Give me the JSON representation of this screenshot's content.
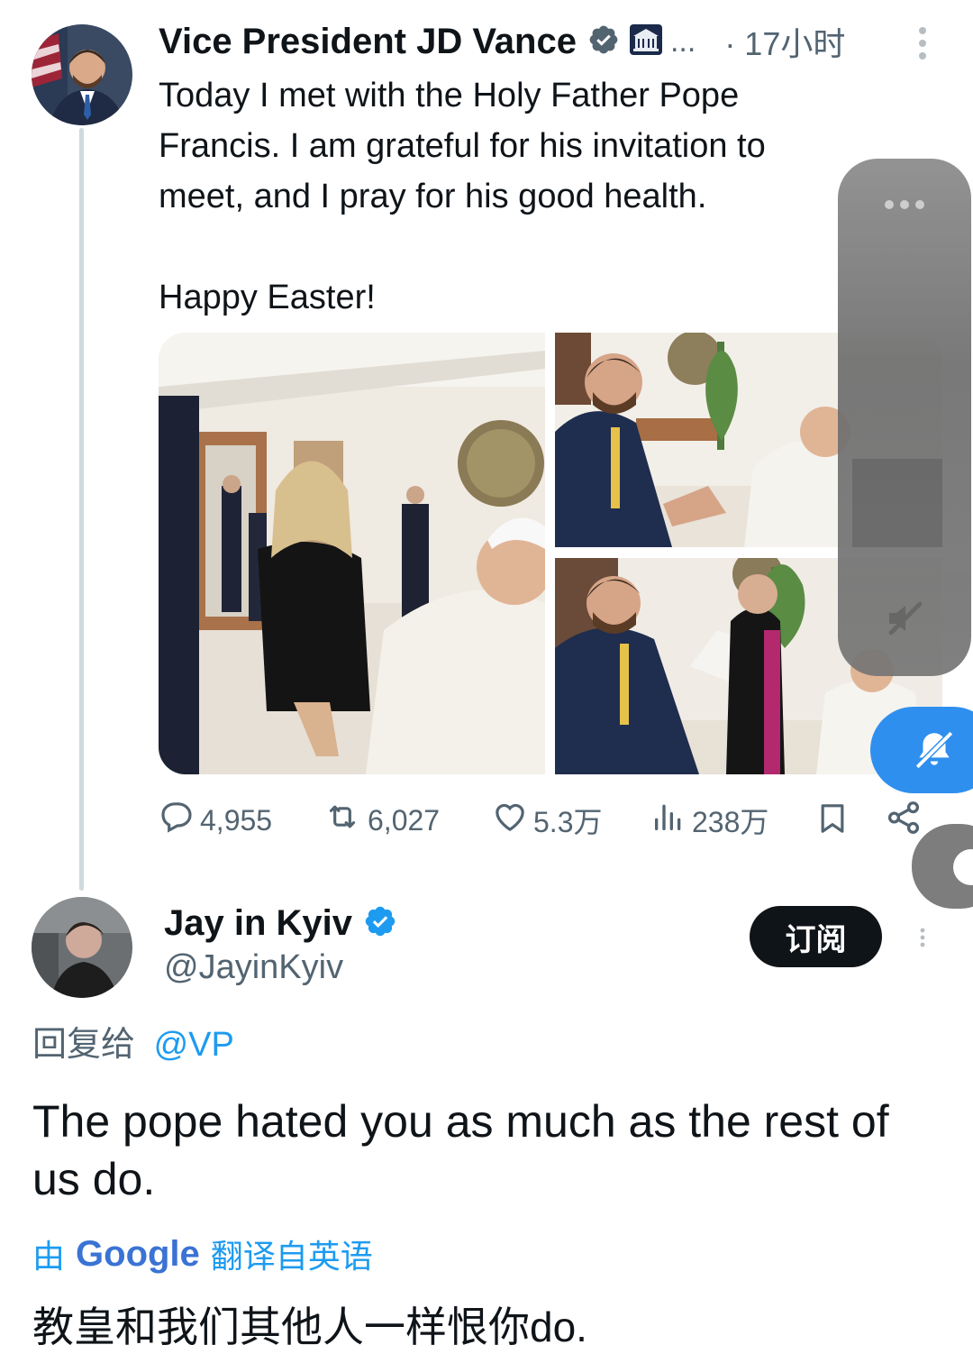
{
  "tweet": {
    "author_name": "Vice President JD Vance",
    "affiliation_ellipsis": "...",
    "timestamp": "· 17小时",
    "text": "Today I met with the Holy Father Pope Francis. I am grateful for his invitation to meet, and I pray for his good health.\n\nHappy Easter!",
    "stats": {
      "replies": "4,955",
      "reposts": "6,027",
      "likes": "5.3万",
      "views": "238万"
    }
  },
  "reply": {
    "author_name": "Jay in Kyiv",
    "handle": "@JayinKyiv",
    "subscribe_label": "订阅",
    "replying_prefix": "回复给",
    "replying_to": "@VP",
    "text": "The pope hated you as much as the rest of us do.",
    "translate_prefix": "由",
    "translate_brand": "Google",
    "translate_suffix": "翻译自英语",
    "translated_text": "教皇和我们其他人一样恨你do."
  },
  "colors": {
    "accent_blue": "#1d9bf0",
    "text_gray": "#536471",
    "mute_button_blue": "#2f8fef"
  },
  "icons": [
    "verified-badge-icon",
    "white-house-icon",
    "more-vertical-icon",
    "reply-icon",
    "repost-icon",
    "like-icon",
    "views-icon",
    "bookmark-icon",
    "share-icon",
    "mute-icon",
    "more-horizontal-icon"
  ]
}
